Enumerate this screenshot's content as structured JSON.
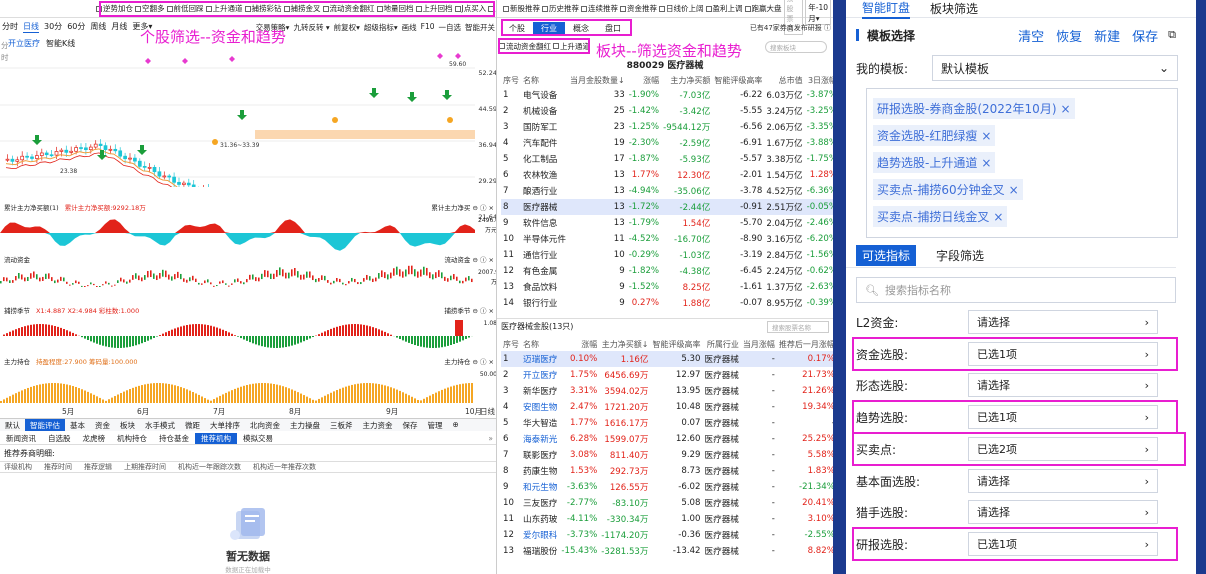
{
  "left": {
    "filters": [
      "逆势加仓",
      "空翻多",
      "前低回踩",
      "上升通道",
      "捕捞彩钻",
      "捕捞金叉",
      "流动资金翻红",
      "地量回档",
      "上升回档",
      "J点买入",
      "主力连续加仓"
    ],
    "timeframes": [
      "分时",
      "日线",
      "30分",
      "60分",
      "周线",
      "月线",
      "更多▾"
    ],
    "toolbar_right": [
      "交易策略▾",
      "九转反转 ▾",
      "前复权▾",
      "超级指标▾",
      "画线",
      "F10",
      "一自选",
      "智能开关"
    ],
    "banner": "个股筛选--资金和趋势",
    "stock_name": "开立医疗",
    "indicator_label": "智能K线",
    "price_axis": [
      "52.24",
      "44.59",
      "36.94",
      "29.29",
      "21.64"
    ],
    "price_callouts": [
      "59.60",
      "31.36~33.39",
      "23.38"
    ],
    "panels": [
      {
        "title": "累计主力净买额(1)",
        "value": "累计主力净买额:9292.18万",
        "right": "累计主力净买 ⊖ ⓘ ×",
        "axis": [
          "2496.05",
          "万元"
        ]
      },
      {
        "title": "流动资金",
        "value": "",
        "right": "流动资金 ⊖ ⓘ ×",
        "axis": [
          "2007.90",
          "万"
        ]
      },
      {
        "title": "捕捞季节",
        "value": "X1:4.887   X2:4.984   彩柱数:1.000",
        "right": "捕捞季节 ⊖ ⓘ ×",
        "axis": [
          "1.08"
        ]
      },
      {
        "title": "主力持仓",
        "value": "持盈程度:27.900   筹码量:100.000",
        "right": "主力持仓 ⊖ ⓘ ×",
        "axis": [
          "50.00"
        ]
      }
    ],
    "dates": [
      "5月",
      "6月",
      "7月",
      "8月",
      "9月",
      "10月",
      "日线"
    ],
    "bottom_tabs": [
      "默认",
      "智能评估",
      "基本",
      "资金",
      "板块",
      "水手模式",
      "微距",
      "大单排序",
      "北向资金",
      "主力操盘",
      "三板斧",
      "主力资金",
      "保存",
      "管理",
      "⊕"
    ],
    "sub_tabs": [
      "新闻资讯",
      "自选股",
      "龙虎榜",
      "机构持仓",
      "持仓基金",
      "推荐机构",
      "模拟交易"
    ],
    "recommend_title": "推荐券商明细:",
    "recommend_cols": [
      "评级机构",
      "推荐时间",
      "推荐逻辑",
      "上期推荐时间",
      "机构近一年跟踪次数",
      "机构近一年推荐次数"
    ],
    "empty_text": "暂无数据",
    "empty_sub": "数据正在加载中"
  },
  "mid": {
    "top_filters": [
      "新股推荐",
      "历史推荐",
      "连续推荐",
      "资金推荐",
      "日线价上阔",
      "盈利上调",
      "跑赢大盘"
    ],
    "year_select": "2022年-10月▾",
    "search_placeholder": "搜索股票名",
    "tabs": [
      "个股",
      "行业",
      "概念",
      "盘口"
    ],
    "tabs_note": "已有47家券商发布研报 ⓘ",
    "sub_filters": [
      "流动资金翻红",
      "上升通道"
    ],
    "banner": "板块--筛选资金和趋势",
    "board_search": "搜索板块",
    "board_code": "880029 医疗器械",
    "sector_cols": [
      "序号",
      "名称",
      "当月金股数量↓",
      "涨幅",
      "主力净买额",
      "智能评级高率",
      "总市值",
      "3日涨幅"
    ],
    "sectors": [
      [
        "1",
        "电气设备",
        "33",
        "-1.90%",
        "-7.03亿",
        "-6.22",
        "6.03万亿",
        "-3.87%"
      ],
      [
        "2",
        "机械设备",
        "25",
        "-1.42%",
        "-3.42亿",
        "-5.55",
        "3.24万亿",
        "-3.25%"
      ],
      [
        "3",
        "国防军工",
        "23",
        "-1.25%",
        "-9544.12万",
        "-6.56",
        "2.06万亿",
        "-3.35%"
      ],
      [
        "4",
        "汽车配件",
        "19",
        "-2.30%",
        "-2.59亿",
        "-6.91",
        "1.67万亿",
        "-3.88%"
      ],
      [
        "5",
        "化工制品",
        "17",
        "-1.87%",
        "-5.93亿",
        "-5.57",
        "3.38万亿",
        "-1.75%"
      ],
      [
        "6",
        "农林牧渔",
        "13",
        "1.77%",
        "12.30亿",
        "-2.01",
        "1.54万亿",
        "1.28%"
      ],
      [
        "7",
        "酿酒行业",
        "13",
        "-4.94%",
        "-35.06亿",
        "-3.78",
        "4.52万亿",
        "-6.36%"
      ],
      [
        "8",
        "医疗器械",
        "13",
        "-1.72%",
        "-2.44亿",
        "-0.91",
        "2.51万亿",
        "-0.05%"
      ],
      [
        "9",
        "软件信息",
        "13",
        "-1.79%",
        "1.54亿",
        "-5.70",
        "2.04万亿",
        "-2.46%"
      ],
      [
        "10",
        "半导体元件",
        "11",
        "-4.52%",
        "-16.70亿",
        "-8.90",
        "3.16万亿",
        "-6.20%"
      ],
      [
        "11",
        "通信行业",
        "10",
        "-0.29%",
        "-1.03亿",
        "-3.19",
        "2.84万亿",
        "-1.56%"
      ],
      [
        "12",
        "有色金属",
        "9",
        "-1.82%",
        "-4.38亿",
        "-6.45",
        "2.24万亿",
        "-0.62%"
      ],
      [
        "13",
        "食品饮料",
        "9",
        "-1.52%",
        "8.25亿",
        "-1.61",
        "1.37万亿",
        "-2.63%"
      ],
      [
        "14",
        "银行行业",
        "9",
        "0.27%",
        "1.88亿",
        "-0.07",
        "8.95万亿",
        "-0.39%"
      ]
    ],
    "selected_sector": 7,
    "stock_section_title": "医疗器械金股(13只)",
    "stock_search": "搜索股票名称",
    "stock_cols": [
      "序号",
      "名称",
      "涨幅",
      "主力净买额↓",
      "智能评级高率",
      "所属行业",
      "当月涨幅",
      "推荐后一月涨幅"
    ],
    "stocks": [
      [
        "1",
        "迈瑞医疗",
        "0.10%",
        "1.16亿",
        "5.30",
        "医疗器械",
        "-",
        "0.17%"
      ],
      [
        "2",
        "开立医疗",
        "1.75%",
        "6456.69万",
        "12.97",
        "医疗器械",
        "-",
        "21.73%"
      ],
      [
        "3",
        "新华医疗",
        "3.31%",
        "3594.02万",
        "13.95",
        "医疗器械",
        "-",
        "21.26%"
      ],
      [
        "4",
        "安图生物",
        "2.47%",
        "1721.20万",
        "10.48",
        "医疗器械",
        "-",
        "19.34%"
      ],
      [
        "5",
        "华大智造",
        "1.77%",
        "1616.17万",
        "0.07",
        "医疗器械",
        "-",
        "-"
      ],
      [
        "6",
        "海泰新光",
        "6.28%",
        "1599.07万",
        "12.60",
        "医疗器械",
        "-",
        "25.25%"
      ],
      [
        "7",
        "联影医疗",
        "3.08%",
        "811.40万",
        "9.29",
        "医疗器械",
        "-",
        "5.58%"
      ],
      [
        "8",
        "药康生物",
        "1.53%",
        "292.73万",
        "8.73",
        "医疗器械",
        "-",
        "1.83%"
      ],
      [
        "9",
        "和元生物",
        "-3.63%",
        "126.55万",
        "-6.02",
        "医疗器械",
        "-",
        "-21.34%"
      ],
      [
        "10",
        "三友医疗",
        "-2.77%",
        "-83.10万",
        "5.08",
        "医疗器械",
        "-",
        "20.41%"
      ],
      [
        "11",
        "山东药玻",
        "-4.11%",
        "-330.34万",
        "1.00",
        "医疗器械",
        "-",
        "3.10%"
      ],
      [
        "12",
        "爱尔眼科",
        "-3.73%",
        "-1174.20万",
        "-0.36",
        "医疗器械",
        "-",
        "-2.55%"
      ],
      [
        "13",
        "福瑞股份",
        "-15.43%",
        "-3281.53万",
        "-13.42",
        "医疗器械",
        "-",
        "8.82%"
      ]
    ],
    "selected_stock": 0
  },
  "right": {
    "tabs": [
      "智能盯盘",
      "板块筛选"
    ],
    "template_title": "模板选择",
    "actions": [
      "清空",
      "恢复",
      "新建",
      "保存"
    ],
    "my_template_label": "我的模板:",
    "my_template_value": "默认模板",
    "selected_tags": [
      "研报选股-券商金股(2022年10月)",
      "资金选股-红肥绿瘦",
      "趋势选股-上升通道",
      "买卖点-捕捞60分钟金叉",
      "买卖点-捕捞日线金叉"
    ],
    "sub_tabs": [
      "可选指标",
      "字段筛选"
    ],
    "search_placeholder": "搜索指标名称",
    "fields": [
      {
        "label": "L2资金:",
        "value": "请选择",
        "hl": false
      },
      {
        "label": "资金选股:",
        "value": "已选1项",
        "hl": true
      },
      {
        "label": "形态选股:",
        "value": "请选择",
        "hl": false
      },
      {
        "label": "趋势选股:",
        "value": "已选1项",
        "hl": true
      },
      {
        "label": "买卖点:",
        "value": "已选2项",
        "hl": true
      },
      {
        "label": "基本面选股:",
        "value": "请选择",
        "hl": false
      },
      {
        "label": "猎手选股:",
        "value": "请选择",
        "hl": false
      },
      {
        "label": "研报选股:",
        "value": "已选1项",
        "hl": true
      }
    ]
  },
  "colors": {
    "up": "#e2231a",
    "down": "#1b9e3b",
    "cyan": "#1cc6d6",
    "accent": "#1560d4",
    "highlight": "#e81ed0",
    "navy": "#1b3a8e"
  }
}
